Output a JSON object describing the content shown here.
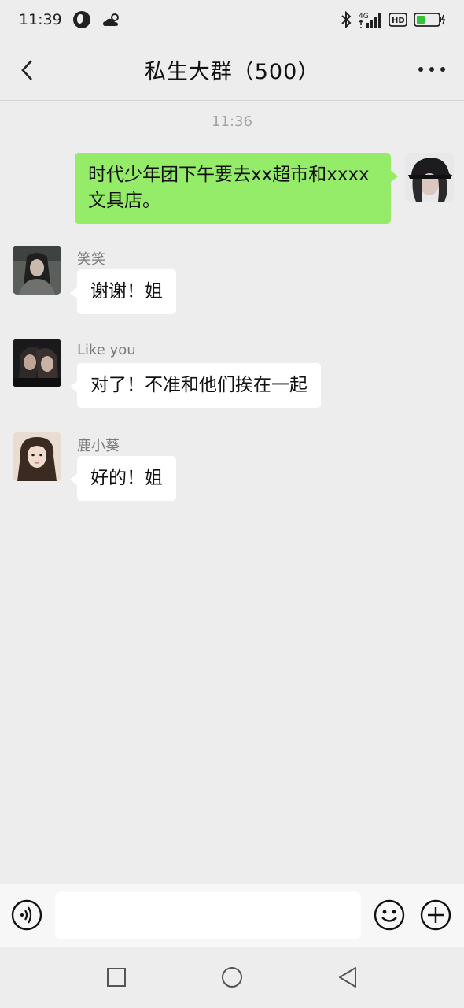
{
  "status_bar": {
    "time": "11:39",
    "network_label": "4G",
    "hd_label": "HD",
    "icons": [
      "globe-icon",
      "cloud-icon",
      "bluetooth-icon",
      "signal-icon",
      "hd-icon",
      "battery-icon"
    ]
  },
  "header": {
    "title": "私生大群（500）",
    "back_icon": "chevron-left-icon",
    "more_icon": "more-dots-icon"
  },
  "chat": {
    "timestamp": "11:36",
    "messages": [
      {
        "sender": "me",
        "name": "",
        "text": "时代少年团下午要去xx超市和xxxx文具店。"
      },
      {
        "sender": "other",
        "name": "笑笑",
        "text": "谢谢！姐"
      },
      {
        "sender": "other",
        "name": "Like you",
        "text": "对了！不准和他们挨在一起"
      },
      {
        "sender": "other",
        "name": "鹿小葵",
        "text": "好的！姐"
      }
    ]
  },
  "input_bar": {
    "placeholder": "",
    "value": "",
    "icons": [
      "voice-icon",
      "emoji-icon",
      "plus-icon"
    ]
  },
  "system_nav": {
    "icons": [
      "recent-apps-icon",
      "home-icon",
      "back-triangle-icon"
    ]
  },
  "colors": {
    "background": "#ededed",
    "my_bubble": "#95ec69",
    "other_bubble": "#ffffff",
    "timestamp": "#a3a3a3",
    "sender_name": "#7a7a7a"
  }
}
